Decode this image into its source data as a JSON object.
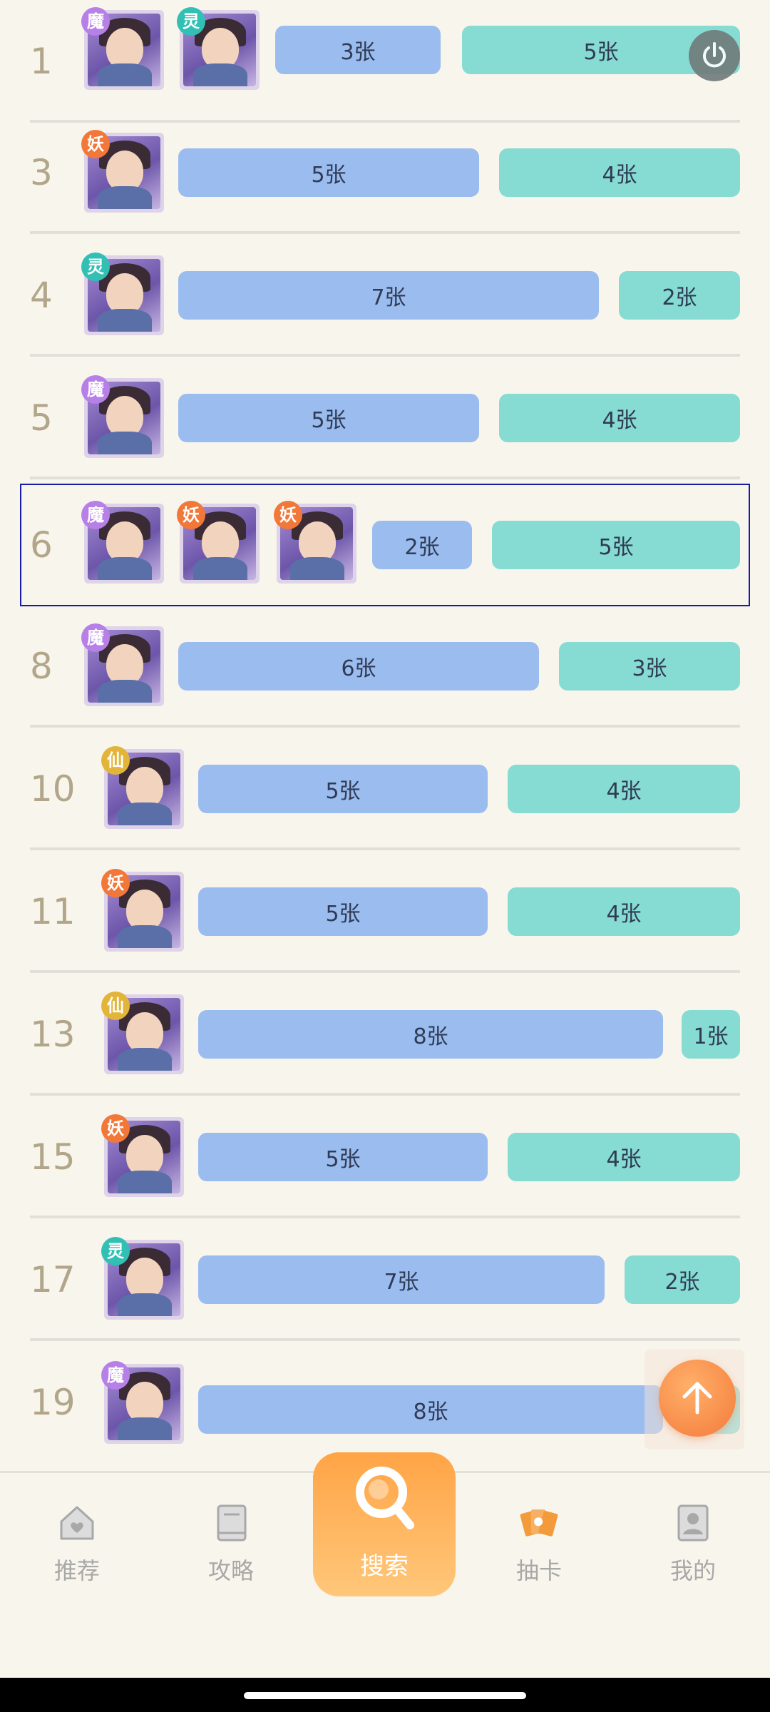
{
  "rows": [
    {
      "rank": "1",
      "tags": [
        "魔",
        "灵"
      ],
      "bar_a": "3张",
      "bar_b": "5张"
    },
    {
      "rank": "3",
      "tags": [
        "妖"
      ],
      "bar_a": "5张",
      "bar_b": "4张"
    },
    {
      "rank": "4",
      "tags": [
        "灵"
      ],
      "bar_a": "7张",
      "bar_b": "2张"
    },
    {
      "rank": "5",
      "tags": [
        "魔"
      ],
      "bar_a": "5张",
      "bar_b": "4张"
    },
    {
      "rank": "6",
      "tags": [
        "魔",
        "妖",
        "妖"
      ],
      "bar_a": "2张",
      "bar_b": "5张"
    },
    {
      "rank": "8",
      "tags": [
        "魔"
      ],
      "bar_a": "6张",
      "bar_b": "3张"
    },
    {
      "rank": "10",
      "tags": [
        "仙"
      ],
      "bar_a": "5张",
      "bar_b": "4张"
    },
    {
      "rank": "11",
      "tags": [
        "妖"
      ],
      "bar_a": "5张",
      "bar_b": "4张"
    },
    {
      "rank": "13",
      "tags": [
        "仙"
      ],
      "bar_a": "8张",
      "bar_b": "1张"
    },
    {
      "rank": "15",
      "tags": [
        "妖"
      ],
      "bar_a": "5张",
      "bar_b": "4张"
    },
    {
      "rank": "17",
      "tags": [
        "灵"
      ],
      "bar_a": "7张",
      "bar_b": "2张"
    },
    {
      "rank": "19",
      "tags": [
        "魔"
      ],
      "bar_a": "8张",
      "bar_b": ""
    }
  ],
  "tag_colors": {
    "魔": "#b77fe8",
    "灵": "#32c0b4",
    "妖": "#f2783a",
    "仙": "#e2b53a"
  },
  "tabs": {
    "recommend": "推荐",
    "guide": "攻略",
    "search": "搜索",
    "draw": "抽卡",
    "mine": "我的"
  },
  "accent": "#f39b3a",
  "icons": {
    "power": "power-icon",
    "scroll_top": "arrow-up-icon",
    "search": "search-icon"
  }
}
